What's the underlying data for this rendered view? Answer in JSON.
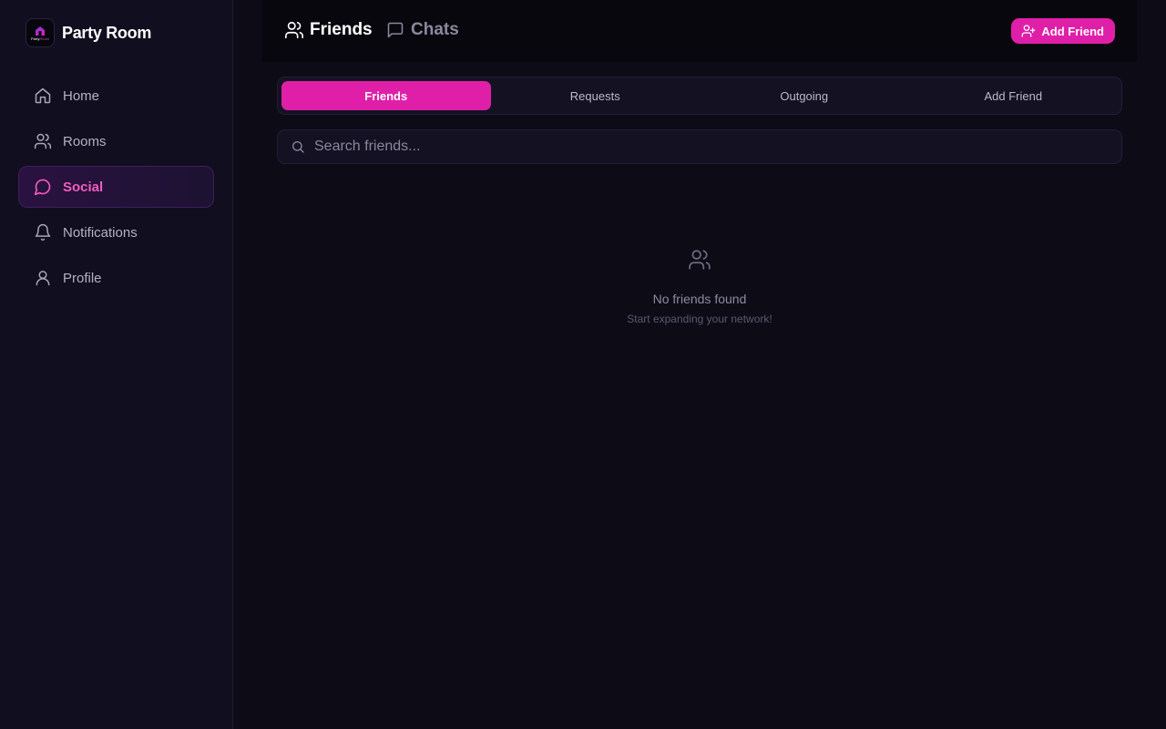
{
  "brand": {
    "name": "Party Room",
    "logo_text_a": "Party",
    "logo_text_b": "Room"
  },
  "sidebar": {
    "items": [
      {
        "label": "Home",
        "icon": "home-icon",
        "active": false
      },
      {
        "label": "Rooms",
        "icon": "users-icon",
        "active": false
      },
      {
        "label": "Social",
        "icon": "message-circle-icon",
        "active": true
      },
      {
        "label": "Notifications",
        "icon": "bell-icon",
        "active": false
      },
      {
        "label": "Profile",
        "icon": "user-icon",
        "active": false
      }
    ]
  },
  "header": {
    "tabs": [
      {
        "label": "Friends",
        "icon": "users-icon",
        "active": true
      },
      {
        "label": "Chats",
        "icon": "message-square-icon",
        "active": false
      }
    ],
    "add_friend_label": "Add Friend",
    "add_friend_icon": "user-plus-icon"
  },
  "segments": [
    {
      "label": "Friends",
      "active": true
    },
    {
      "label": "Requests",
      "active": false
    },
    {
      "label": "Outgoing",
      "active": false
    },
    {
      "label": "Add Friend",
      "active": false
    }
  ],
  "search": {
    "placeholder": "Search friends...",
    "value": ""
  },
  "empty_state": {
    "icon": "users-icon",
    "title": "No friends found",
    "subtitle": "Start expanding your network!"
  },
  "colors": {
    "accent": "#e01fa8",
    "active_nav_text": "#f05cc0",
    "background": "#0d0b16",
    "sidebar": "#110e1f"
  }
}
